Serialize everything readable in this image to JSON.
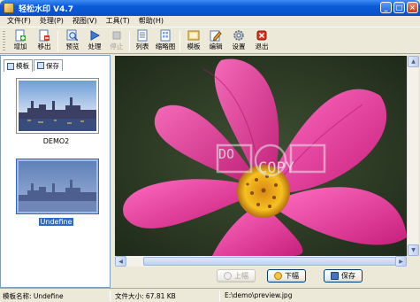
{
  "window": {
    "title": "轻松水印  V4.7"
  },
  "menu": [
    {
      "label": "文件(F)"
    },
    {
      "label": "处理(P)"
    },
    {
      "label": "视图(V)"
    },
    {
      "label": "工具(T)"
    },
    {
      "label": "帮助(H)"
    }
  ],
  "toolbar": {
    "add": "增加",
    "remove": "移出",
    "preview": "预览",
    "process": "处理",
    "stop": "停止",
    "list": "列表",
    "thumbnails": "缩略图",
    "template": "模板",
    "edit": "编辑",
    "settings": "设置",
    "exit": "退出"
  },
  "left_panel": {
    "tabs": [
      {
        "label": "模板"
      },
      {
        "label": "保存"
      }
    ],
    "items": [
      {
        "caption": "DEMO2"
      },
      {
        "caption": "Undefine"
      }
    ]
  },
  "preview": {
    "watermark_text_1": "DO",
    "watermark_text_2": "COPY"
  },
  "buttons": {
    "prev": "上幅",
    "next": "下幅",
    "save": "保存"
  },
  "status": {
    "template_name": "模板名称: Undefine",
    "file_size": "文件大小: 67.81 KB",
    "file_path": "E:\\demo\\preview.jpg"
  },
  "colors": {
    "titlebar": "#0a5ad9",
    "flower": "#e0358f",
    "selection": "#316ac5"
  }
}
